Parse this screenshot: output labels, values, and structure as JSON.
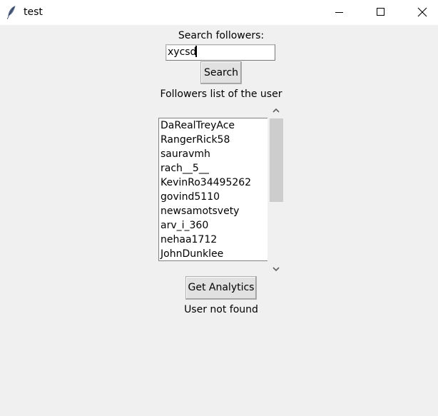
{
  "window": {
    "title": "test",
    "icon": "feather-icon",
    "controls": [
      "minimize-icon",
      "maximize-icon",
      "close-icon"
    ]
  },
  "search": {
    "label": "Search followers:",
    "value": "xycsd",
    "button_label": "Search"
  },
  "followers": {
    "label": "Followers list of the user",
    "items": [
      "DaRealTreyAce",
      "RangerRick58",
      "sauravmh",
      "rach__5__",
      "KevinRo34495262",
      "govind5110",
      "newsamotsvety",
      "arv_i_360",
      "nehaa1712",
      "JohnDunklee"
    ]
  },
  "analytics": {
    "button_label": "Get Analytics",
    "status": "User not found"
  }
}
